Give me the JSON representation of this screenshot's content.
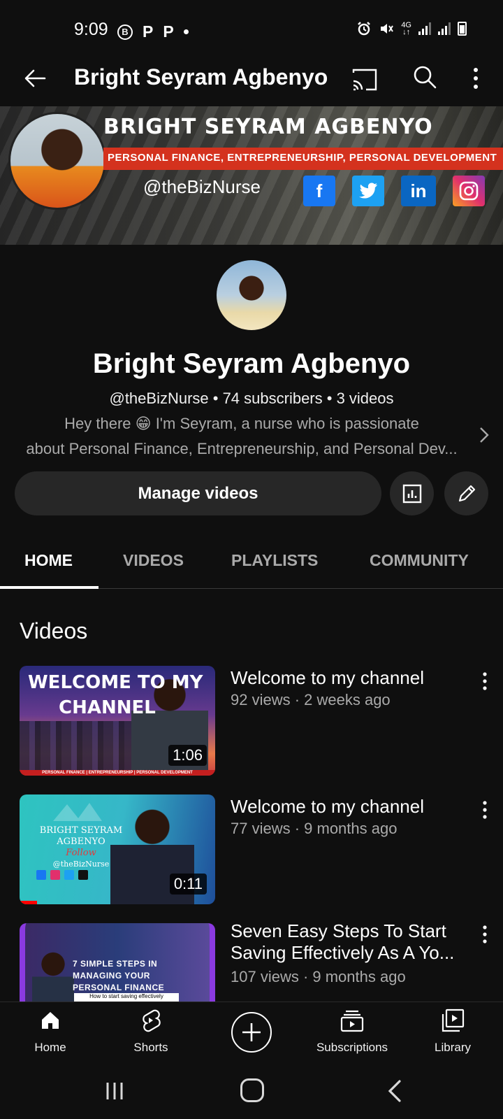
{
  "status_bar": {
    "time": "9:09",
    "left_icons": [
      "b-circle-icon",
      "p-icon",
      "p-icon",
      "dot-icon"
    ],
    "right_icons": [
      "alarm-icon",
      "mute-icon",
      "4g-icon",
      "signal-icon",
      "signal-icon",
      "battery-icon"
    ],
    "network": "4G"
  },
  "app_bar": {
    "title": "Bright Seyram Agbenyo"
  },
  "banner": {
    "title": "BRIGHT SEYRAM AGBENYO",
    "subtitle": "PERSONAL FINANCE, ENTREPRENEURSHIP,  PERSONAL DEVELOPMENT",
    "handle": "@theBizNurse",
    "social": [
      "f",
      "in"
    ]
  },
  "channel": {
    "name": "Bright Seyram Agbenyo",
    "meta": "@theBizNurse • 74 subscribers • 3 videos",
    "description_line1": "Hey there 😁 I'm Seyram, a nurse who is passionate",
    "description_line2": "about Personal Finance, Entrepreneurship, and Personal Dev..."
  },
  "actions": {
    "manage_label": "Manage videos"
  },
  "tabs": [
    {
      "label": "HOME",
      "active": true
    },
    {
      "label": "VIDEOS",
      "active": false
    },
    {
      "label": "PLAYLISTS",
      "active": false
    },
    {
      "label": "COMMUNITY",
      "active": false
    }
  ],
  "videos_section": {
    "title": "Videos",
    "items": [
      {
        "title": "Welcome to my channel",
        "meta": "92 views · 2 weeks ago",
        "duration": "1:06",
        "thumb_text_line1": "WELCOME TO MY",
        "thumb_text_line2": "CHANNEL",
        "thumb_footer": "PERSONAL FINANCE | ENTREPRENEURSHIP | PERSONAL DEVELOPMENT"
      },
      {
        "title": "Welcome to my channel",
        "meta": "77 views · 9 months ago",
        "duration": "0:11",
        "thumb_text_line1": "BRIGHT SEYRAM",
        "thumb_text_line2": "AGBENYO",
        "thumb_text_line3": "Follow",
        "thumb_text_line4": "@theBizNurse",
        "watched_fraction": 0.09
      },
      {
        "title": "Seven Easy Steps To Start Saving Effectively As A Yo...",
        "meta": "107 views · 9 months ago",
        "thumb_text_line1": "7 SIMPLE STEPS IN",
        "thumb_text_line2": "MANAGING YOUR",
        "thumb_text_line3": "PERSONAL FINANCE",
        "thumb_footer": "How to start saving effectively"
      }
    ]
  },
  "bottom_nav": {
    "home": "Home",
    "shorts": "Shorts",
    "subscriptions": "Subscriptions",
    "library": "Library"
  }
}
